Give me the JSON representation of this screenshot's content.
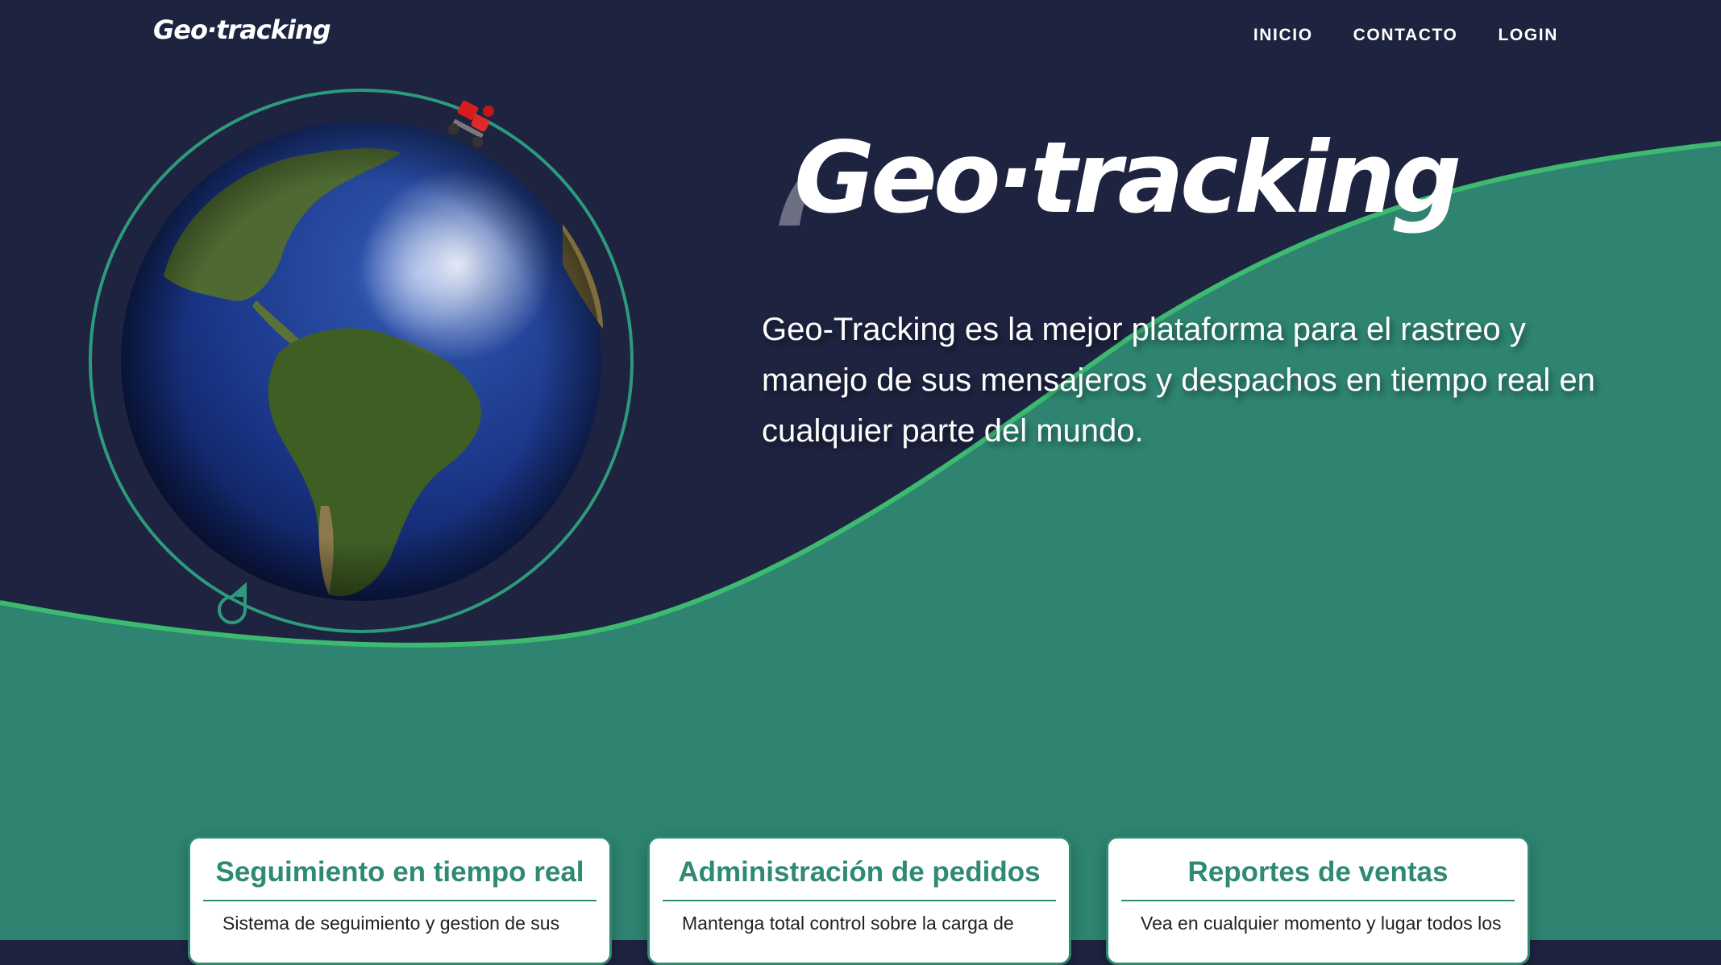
{
  "colors": {
    "navy_background": "#1e2340",
    "teal_section": "#2e8471",
    "green_wave_line": "#3dba70",
    "orbit_ring": "#2e9a7c",
    "card_accent": "#2e8a72"
  },
  "header": {
    "brand": "Geo·tracking",
    "nav": [
      {
        "label": "INICIO"
      },
      {
        "label": "CONTACTO"
      },
      {
        "label": "LOGIN"
      }
    ]
  },
  "hero": {
    "logo_text": "Geo·tracking",
    "description": "Geo-Tracking es la mejor plataforma para el rastreo y manejo de sus mensajeros y despachos en tiempo real en cualquier parte del mundo.",
    "globe_icon": "globe-earth-icon",
    "courier_icon": "delivery-scooter-icon",
    "pin_icon": "location-pin-icon"
  },
  "features": [
    {
      "title": "Seguimiento en tiempo real",
      "text": "Sistema de seguimiento y gestion de sus"
    },
    {
      "title": "Administración de pedidos",
      "text": "Mantenga total control sobre la carga de"
    },
    {
      "title": "Reportes de ventas",
      "text": "Vea en cualquier momento y lugar todos los"
    }
  ]
}
